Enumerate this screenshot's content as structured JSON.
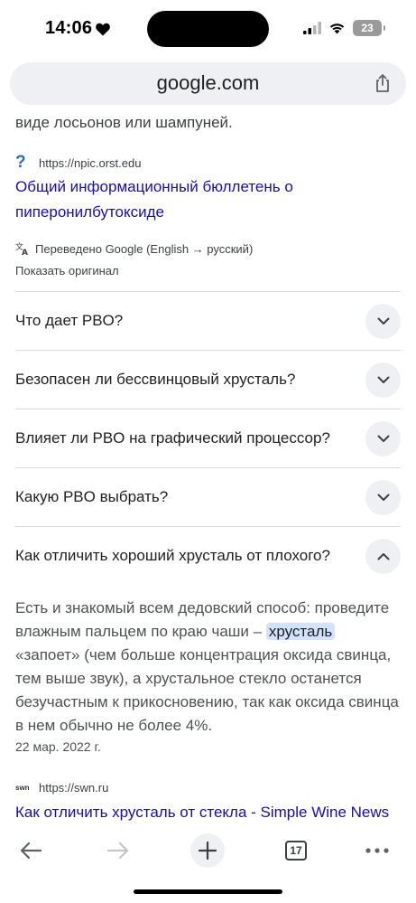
{
  "status_bar": {
    "time": "14:06",
    "battery": "23"
  },
  "browser": {
    "url": "google.com",
    "tab_count": "17"
  },
  "results": {
    "cut_text": "виде лосьонов или шампуней.",
    "first": {
      "source_url": "https://npic.orst.edu",
      "title": "Общий информационный бюллетень о пиперонилбутоксиде"
    },
    "translated_note": "Переведено Google (English → русский)",
    "show_original": "Показать оригинал",
    "faq": [
      {
        "question": "Что дает PBO?",
        "expanded": false
      },
      {
        "question": "Безопасен ли бессвинцовый хрусталь?",
        "expanded": false
      },
      {
        "question": "Влияет ли PBO на графический процессор?",
        "expanded": false
      },
      {
        "question": "Какую PBO выбрать?",
        "expanded": false
      },
      {
        "question": "Как отличить хороший хрусталь от плохого?",
        "expanded": true
      }
    ],
    "answer": {
      "part1": "Есть и знакомый всем дедовский способ: проведите влажным пальцем по краю чаши –",
      "highlight": "хрусталь",
      "part2": "«запоет» (чем больше концентрация оксида свинца, тем выше звук), а хрустальное стекло останется безучастным к прикосновению, так как оксида свинца в нем обычно не более 4%.",
      "date": "22 мар. 2022 г."
    },
    "second": {
      "favicon_text": "swn",
      "source_url": "https://swn.ru",
      "title": "Как отличить хрусталь от стекла - Simple Wine News"
    }
  },
  "colors": {
    "link": "#1a0dab",
    "highlight": "#d3e3fd",
    "chip_bg": "#eef0f3"
  },
  "icons": [
    "heart-icon",
    "cellular-signal-icon",
    "wifi-icon",
    "battery-icon",
    "share-icon",
    "translate-icon",
    "chevron-down-icon",
    "chevron-up-icon",
    "back-arrow-icon",
    "forward-arrow-icon",
    "plus-icon",
    "tabs-icon",
    "more-icon"
  ]
}
